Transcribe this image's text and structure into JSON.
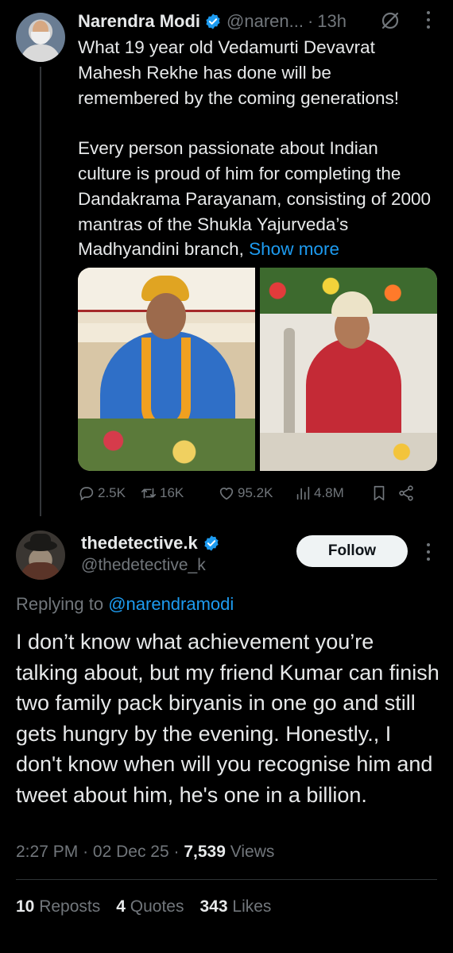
{
  "parent_tweet": {
    "author_name": "Narendra Modi",
    "handle": "@naren...",
    "separator": "·",
    "time": "13h",
    "paragraphs": [
      "What 19 year old Vedamurti Devavrat Mahesh Rekhe has done will be remembered by the coming generations!",
      "Every person passionate about Indian culture is proud of him for completing the Dandakrama Parayanam, consisting of 2000 mantras of the Shukla Yajurveda’s Madhyandini branch,"
    ],
    "show_more": "Show more",
    "stats": {
      "replies": "2.5K",
      "reposts": "16K",
      "likes": "95.2K",
      "views": "4.8M"
    }
  },
  "reply_tweet": {
    "author_name": "thedetective.k",
    "handle": "@thedetective_k",
    "follow_label": "Follow",
    "replying_prefix": "Replying to",
    "replying_mention": "@narendramodi",
    "text": "I don’t know what achievement you’re talking about, but my friend Kumar can finish two family pack biryanis in one go and still gets hungry by the evening. Honestly., I don't know when will you recognise him and tweet about him, he's one in a billion.",
    "time": "2:27 PM",
    "separator": "·",
    "date": "02 Dec 25",
    "views_count": "7,539",
    "views_label": "Views",
    "reposts_count": "10",
    "reposts_label": "Reposts",
    "quotes_count": "4",
    "quotes_label": "Quotes",
    "likes_count": "343",
    "likes_label": "Likes"
  },
  "colors": {
    "background": "#000000",
    "text_primary": "#e7e9ea",
    "text_secondary": "#71767b",
    "accent_blue": "#1d9bf0",
    "verified_blue": "#1d9bf0",
    "divider": "#2f3336"
  },
  "icons": [
    "verified-icon",
    "grok-icon",
    "more-icon",
    "reply-icon",
    "repost-icon",
    "like-icon",
    "views-icon",
    "bookmark-icon",
    "share-icon"
  ]
}
